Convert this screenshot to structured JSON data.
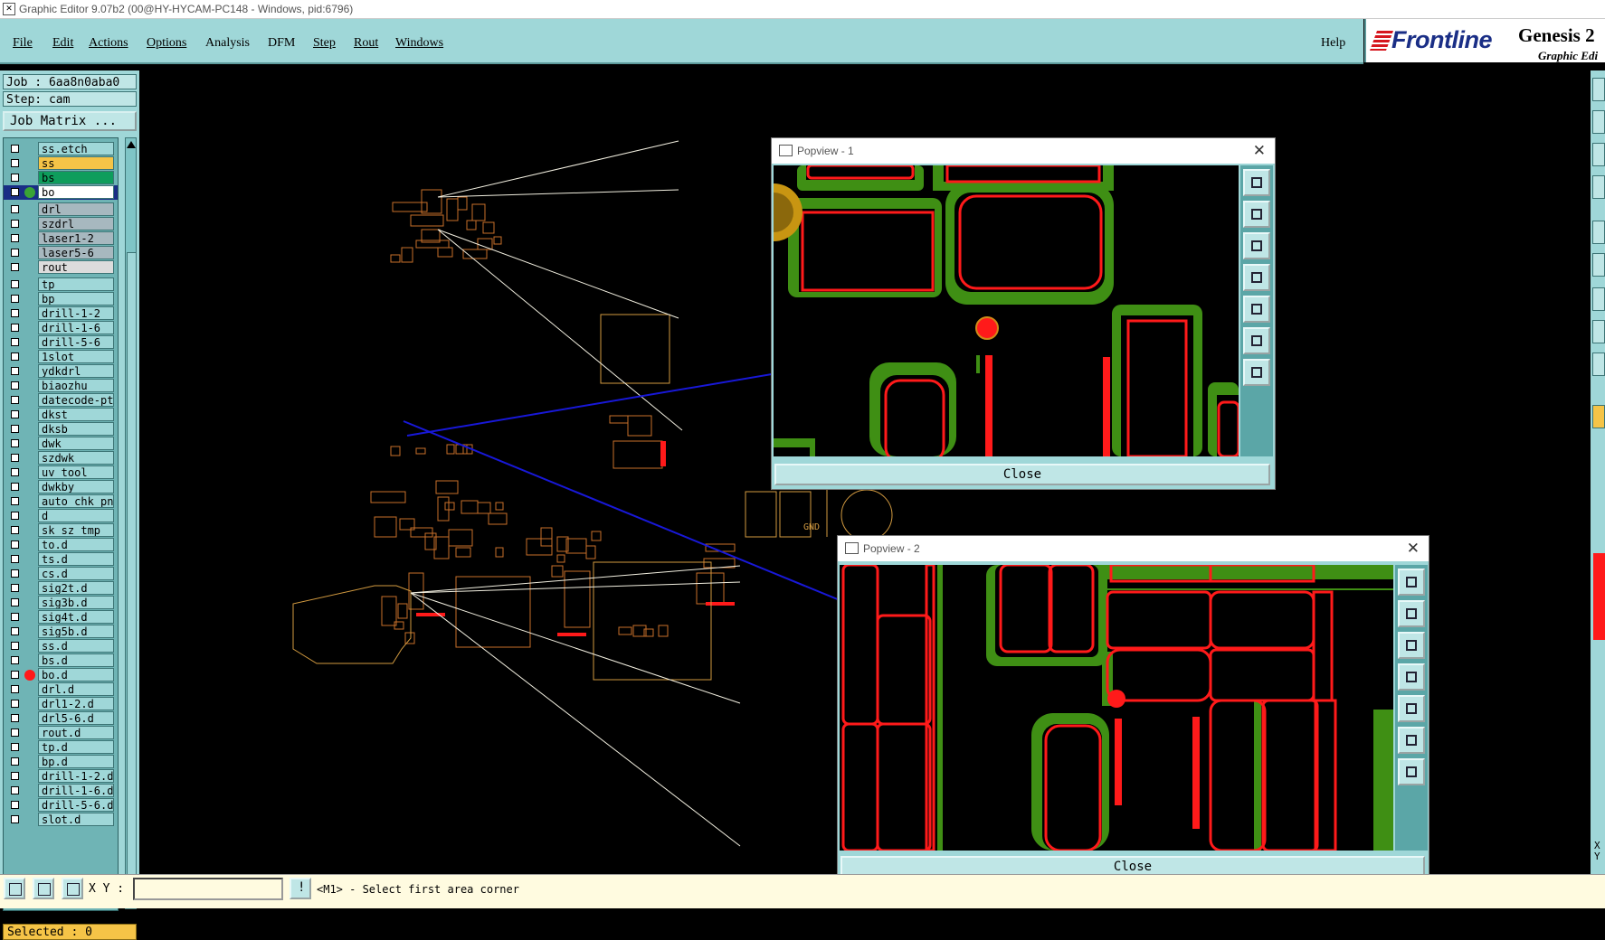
{
  "window": {
    "title": "Graphic Editor 9.07b2 (00@HY-HYCAM-PC148 - Windows, pid:6796)"
  },
  "menu": {
    "file": "File",
    "edit": "Edit",
    "actions": "Actions",
    "options": "Options",
    "analysis": "Analysis",
    "dfm": "DFM",
    "step": "Step",
    "rout": "Rout",
    "windows": "Windows",
    "help": "Help"
  },
  "logo": {
    "brand": "Frontline",
    "product": "Genesis 2",
    "subtitle": "Graphic Edi"
  },
  "job": {
    "job_line": "Job : 6aa8n0aba0",
    "step_line": "Step: cam",
    "matrix_button": "Job Matrix ..."
  },
  "layers": [
    {
      "name": "ss.etch",
      "color": "#9fd7d8"
    },
    {
      "name": "ss",
      "color": "#f5c447"
    },
    {
      "name": "bs",
      "color": "#0e9d5c"
    },
    {
      "name": "bo",
      "color": "#ffffff",
      "active": true
    },
    {
      "name": "drl",
      "color": "#a7b8bf"
    },
    {
      "name": "szdrl",
      "color": "#a7b8bf"
    },
    {
      "name": "laser1-2",
      "color": "#a7b8bf"
    },
    {
      "name": "laser5-6",
      "color": "#a7b8bf"
    },
    {
      "name": "rout",
      "color": "#dcdcdc"
    },
    {
      "name": "tp",
      "color": "#9fd7d8"
    },
    {
      "name": "bp",
      "color": "#9fd7d8"
    },
    {
      "name": "drill-1-2",
      "color": "#9fd7d8"
    },
    {
      "name": "drill-1-6",
      "color": "#9fd7d8"
    },
    {
      "name": "drill-5-6",
      "color": "#9fd7d8"
    },
    {
      "name": "1slot",
      "color": "#9fd7d8"
    },
    {
      "name": "ydkdrl",
      "color": "#9fd7d8"
    },
    {
      "name": "biaozhu",
      "color": "#9fd7d8"
    },
    {
      "name": "datecode-pt",
      "color": "#9fd7d8"
    },
    {
      "name": "dkst",
      "color": "#9fd7d8"
    },
    {
      "name": "dksb",
      "color": "#9fd7d8"
    },
    {
      "name": "dwk",
      "color": "#9fd7d8"
    },
    {
      "name": "szdwk",
      "color": "#9fd7d8"
    },
    {
      "name": "uv_tool",
      "color": "#9fd7d8"
    },
    {
      "name": "dwkby",
      "color": "#9fd7d8"
    },
    {
      "name": "auto_chk_pn",
      "color": "#9fd7d8"
    },
    {
      "name": "d",
      "color": "#9fd7d8"
    },
    {
      "name": "sk_sz_tmp",
      "color": "#9fd7d8"
    },
    {
      "name": "to.d",
      "color": "#9fd7d8",
      "marker": true
    },
    {
      "name": "ts.d",
      "color": "#9fd7d8"
    },
    {
      "name": "cs.d",
      "color": "#9fd7d8"
    },
    {
      "name": "sig2t.d",
      "color": "#9fd7d8"
    },
    {
      "name": "sig3b.d",
      "color": "#9fd7d8"
    },
    {
      "name": "sig4t.d",
      "color": "#9fd7d8"
    },
    {
      "name": "sig5b.d",
      "color": "#9fd7d8"
    },
    {
      "name": "ss.d",
      "color": "#9fd7d8"
    },
    {
      "name": "bs.d",
      "color": "#9fd7d8"
    },
    {
      "name": "bo.d",
      "color": "#9fd7d8",
      "marker": true,
      "dot": "#ff1a1a"
    },
    {
      "name": "drl.d",
      "color": "#9fd7d8"
    },
    {
      "name": "drl1-2.d",
      "color": "#9fd7d8"
    },
    {
      "name": "drl5-6.d",
      "color": "#9fd7d8"
    },
    {
      "name": "rout.d",
      "color": "#9fd7d8"
    },
    {
      "name": "tp.d",
      "color": "#9fd7d8"
    },
    {
      "name": "bp.d",
      "color": "#9fd7d8"
    },
    {
      "name": "drill-1-2.d",
      "color": "#9fd7d8"
    },
    {
      "name": "drill-1-6.d",
      "color": "#9fd7d8"
    },
    {
      "name": "drill-5-6.d",
      "color": "#9fd7d8"
    },
    {
      "name": "slot.d",
      "color": "#9fd7d8"
    }
  ],
  "status": {
    "selected": "Selected : 0",
    "xy_label": "X Y :",
    "xy_value": "",
    "message": "<M1> - Select first area corner"
  },
  "popview1": {
    "title": "Popview - 1",
    "close": "Close"
  },
  "popview2": {
    "title": "Popview - 2",
    "close": "Close"
  },
  "canvas": {
    "label": "GND"
  },
  "right": {
    "xy": "X\nY"
  },
  "colors": {
    "panel": "#9fd7d8",
    "pad_red": "#ff1a1a",
    "fill_green": "#3f8f14",
    "highlight": "#f5c447"
  }
}
